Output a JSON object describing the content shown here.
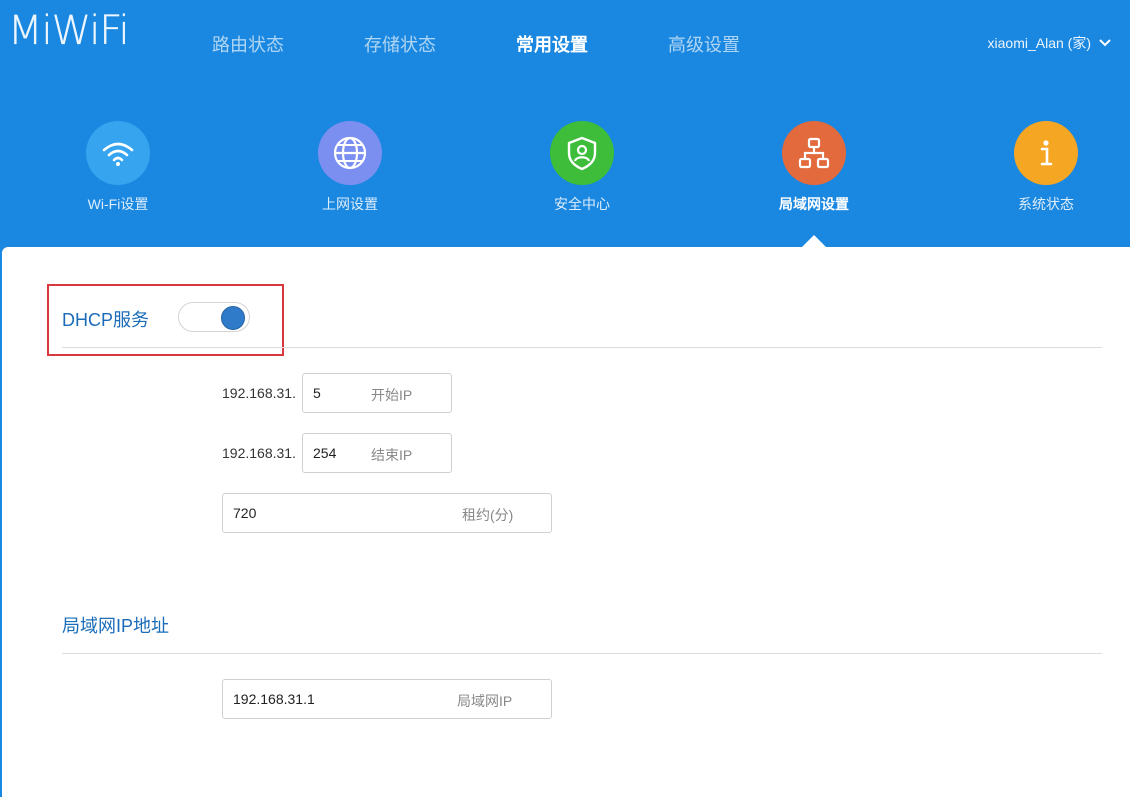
{
  "brand": {
    "logo": "MiWiFi"
  },
  "topnav": {
    "items": [
      "路由状态",
      "存储状态",
      "常用设置",
      "高级设置"
    ],
    "active": "常用设置"
  },
  "user": {
    "name": "xiaomi_Alan (家)"
  },
  "categories": [
    {
      "label": "Wi-Fi设置",
      "icon": "wifi-icon",
      "color": "#36a4ee"
    },
    {
      "label": "上网设置",
      "icon": "globe-icon",
      "color": "#7b8ff0"
    },
    {
      "label": "安全中心",
      "icon": "shield-icon",
      "color": "#3dbd3a"
    },
    {
      "label": "局域网设置",
      "icon": "network-icon",
      "color": "#e26a3c",
      "active": true
    },
    {
      "label": "系统状态",
      "icon": "info-icon",
      "color": "#f5a623"
    }
  ],
  "dhcp": {
    "title": "DHCP服务",
    "enabled": true,
    "prefix": "192.168.31.",
    "start_ip": {
      "value": "5",
      "hint": "开始IP"
    },
    "end_ip": {
      "value": "254",
      "hint": "结束IP"
    },
    "lease": {
      "value": "720",
      "hint": "租约(分)"
    }
  },
  "lan_ip": {
    "title": "局域网IP地址",
    "value": "192.168.31.1",
    "hint": "局域网IP"
  },
  "colors": {
    "header_bg": "#1a87e0",
    "section_title": "#1a6cb8",
    "toggle_knob": "#2f7bc9",
    "highlight": "#d9363e"
  }
}
